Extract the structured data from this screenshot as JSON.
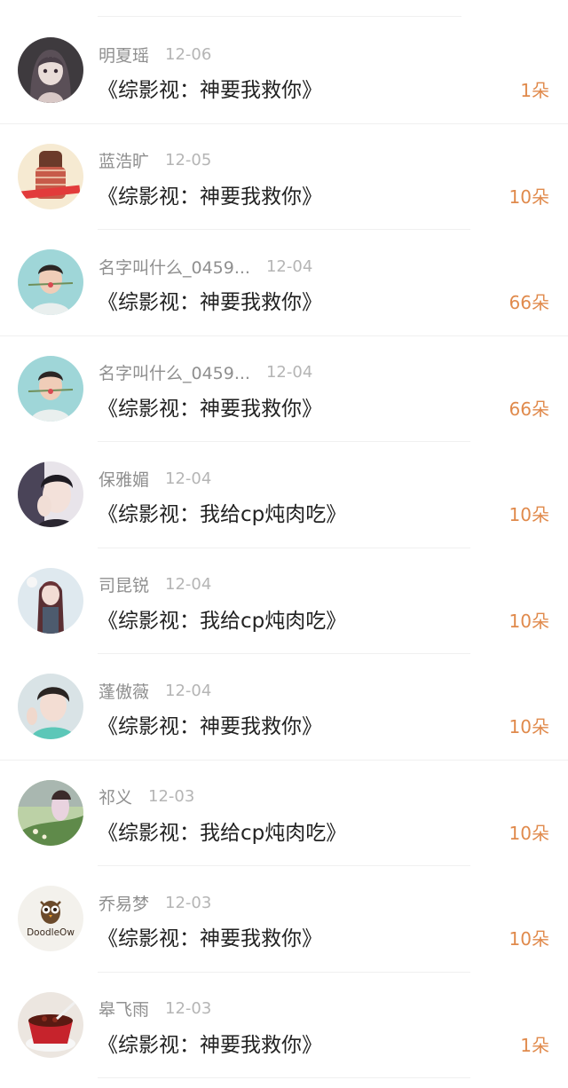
{
  "theme": {
    "name_color": "#8f8f8f",
    "date_color": "#b5b5b5",
    "title_color": "#222222",
    "amount_color": "#e08a4c"
  },
  "items": [
    {
      "name": "明夏瑶",
      "date": "12-06",
      "title": "《综影视：神要我救你》",
      "amount": "1朵",
      "avatar": "anime-girl"
    },
    {
      "name": "蓝浩旷",
      "date": "12-05",
      "title": "《综影视：神要我救你》",
      "amount": "10朵",
      "avatar": "girl-sweater"
    },
    {
      "name": "名字叫什么_0459...",
      "date": "12-04",
      "title": "《综影视：神要我救你》",
      "amount": "66朵",
      "avatar": "man-rose"
    },
    {
      "name": "名字叫什么_0459...",
      "date": "12-04",
      "title": "《综影视：神要我救你》",
      "amount": "66朵",
      "avatar": "man-rose"
    },
    {
      "name": "保雅媚",
      "date": "12-04",
      "title": "《综影视：我给cp炖肉吃》",
      "amount": "10朵",
      "avatar": "girl-hands"
    },
    {
      "name": "司昆锐",
      "date": "12-04",
      "title": "《综影视：我给cp炖肉吃》",
      "amount": "10朵",
      "avatar": "anime-longhair"
    },
    {
      "name": "蓬傲薇",
      "date": "12-04",
      "title": "《综影视：神要我救你》",
      "amount": "10朵",
      "avatar": "boy-selfie"
    },
    {
      "name": "祁义",
      "date": "12-03",
      "title": "《综影视：我给cp炖肉吃》",
      "amount": "10朵",
      "avatar": "garden"
    },
    {
      "name": "乔易梦",
      "date": "12-03",
      "title": "《综影视：神要我救你》",
      "amount": "10朵",
      "avatar": "doodle-owl",
      "avatar_text": "DoodleOw"
    },
    {
      "name": "皋飞雨",
      "date": "12-03",
      "title": "《综影视：神要我救你》",
      "amount": "1朵",
      "avatar": "dessert-bowl"
    }
  ]
}
